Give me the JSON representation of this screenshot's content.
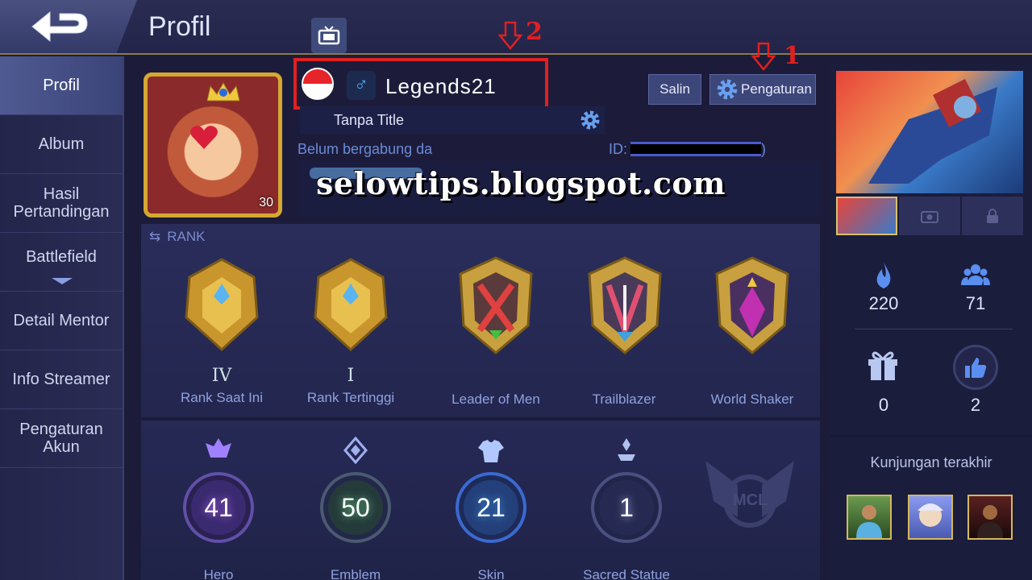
{
  "header": {
    "title": "Profil"
  },
  "sidebar": {
    "items": [
      {
        "label": "Profil"
      },
      {
        "label": "Album"
      },
      {
        "label": "Hasil Pertandingan"
      },
      {
        "label": "Battlefield"
      },
      {
        "label": "Detail Mentor"
      },
      {
        "label": "Info Streamer"
      },
      {
        "label": "Pengaturan Akun"
      }
    ]
  },
  "profile": {
    "username": "Legends21",
    "gender_symbol": "♂",
    "title": "Tanpa Title",
    "joined_text": "Belum bergabung da",
    "id_label": "ID:",
    "id_close": ")",
    "level": "30",
    "bio_watermark": "selowtips.blogspot.com",
    "copy_label": "Salin",
    "settings_label": "Pengaturan",
    "annotation_1": "1",
    "annotation_2": "2"
  },
  "rank": {
    "header": "RANK",
    "badges": [
      {
        "roman": "IV",
        "label": "Rank Saat Ini"
      },
      {
        "roman": "I",
        "label": "Rank Tertinggi"
      },
      {
        "roman": "",
        "label": "Leader of Men"
      },
      {
        "roman": "",
        "label": "Trailblazer"
      },
      {
        "roman": "",
        "label": "World Shaker"
      }
    ]
  },
  "stats": [
    {
      "value": "41",
      "label": "Hero",
      "color": "#c070ff"
    },
    {
      "value": "50",
      "label": "Emblem",
      "color": "#70d890"
    },
    {
      "value": "21",
      "label": "Skin",
      "color": "#4aa8ff"
    },
    {
      "value": "1",
      "label": "Sacred Statue",
      "color": "#b0b8e8"
    }
  ],
  "mcl_label": "MCL",
  "right": {
    "stats": [
      {
        "value": "220",
        "icon": "fire-icon"
      },
      {
        "value": "71",
        "icon": "group-icon"
      },
      {
        "value": "0",
        "icon": "gift-icon"
      },
      {
        "value": "2",
        "icon": "thumbs-up-icon"
      }
    ],
    "visit_title": "Kunjungan terakhir"
  }
}
